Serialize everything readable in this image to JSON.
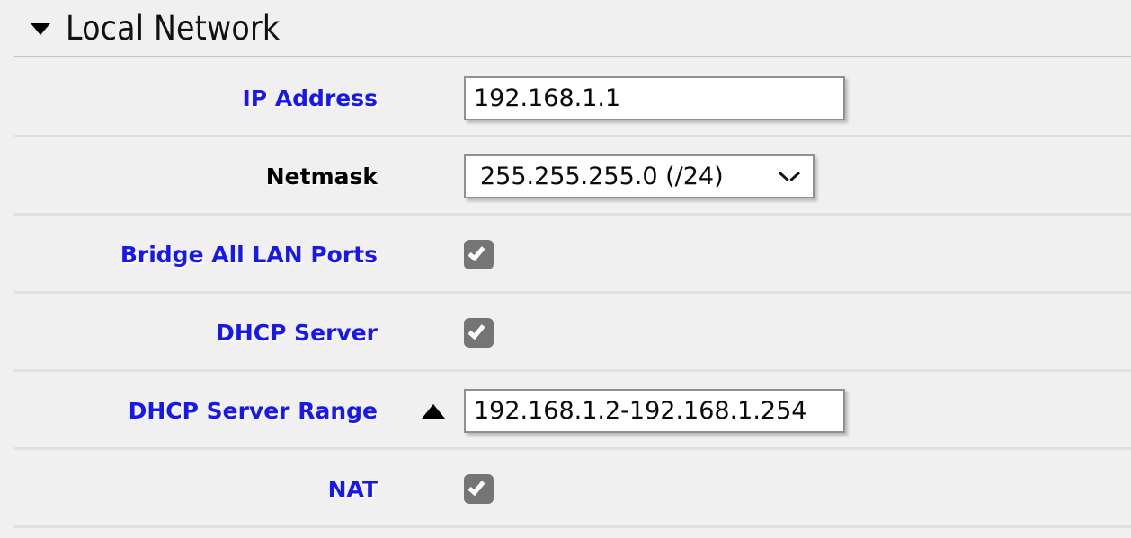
{
  "section": {
    "title": "Local Network",
    "expanded": true,
    "disclosure_icon": "triangle-down-icon"
  },
  "colors": {
    "background": "#f0f0f0",
    "label_link": "#1818ee",
    "label_plain": "#000000",
    "checkbox_checked": "#757575",
    "input_border": "#909090",
    "divider": "#e0e0e0",
    "header_divider": "#c6c6c6"
  },
  "rows": [
    {
      "id": "ip-address",
      "label": "IP Address",
      "label_style": "link",
      "control": "text",
      "value": "192.168.1.1",
      "placeholder": ""
    },
    {
      "id": "netmask",
      "label": "Netmask",
      "label_style": "plain",
      "control": "select",
      "value": "255.255.255.0 (/24)",
      "chevron_icon": "chevron-down-icon"
    },
    {
      "id": "bridge-all-lan-ports",
      "label": "Bridge All LAN Ports",
      "label_style": "link",
      "control": "checkbox",
      "checked": true
    },
    {
      "id": "dhcp-server",
      "label": "DHCP Server",
      "label_style": "link",
      "control": "checkbox",
      "checked": true
    },
    {
      "id": "dhcp-server-range",
      "label": "DHCP Server Range",
      "label_style": "link",
      "control": "text",
      "value": "192.168.1.2-192.168.1.254",
      "placeholder": "",
      "marker_icon": "triangle-up-icon"
    },
    {
      "id": "nat",
      "label": "NAT",
      "label_style": "link",
      "control": "checkbox",
      "checked": true
    }
  ]
}
